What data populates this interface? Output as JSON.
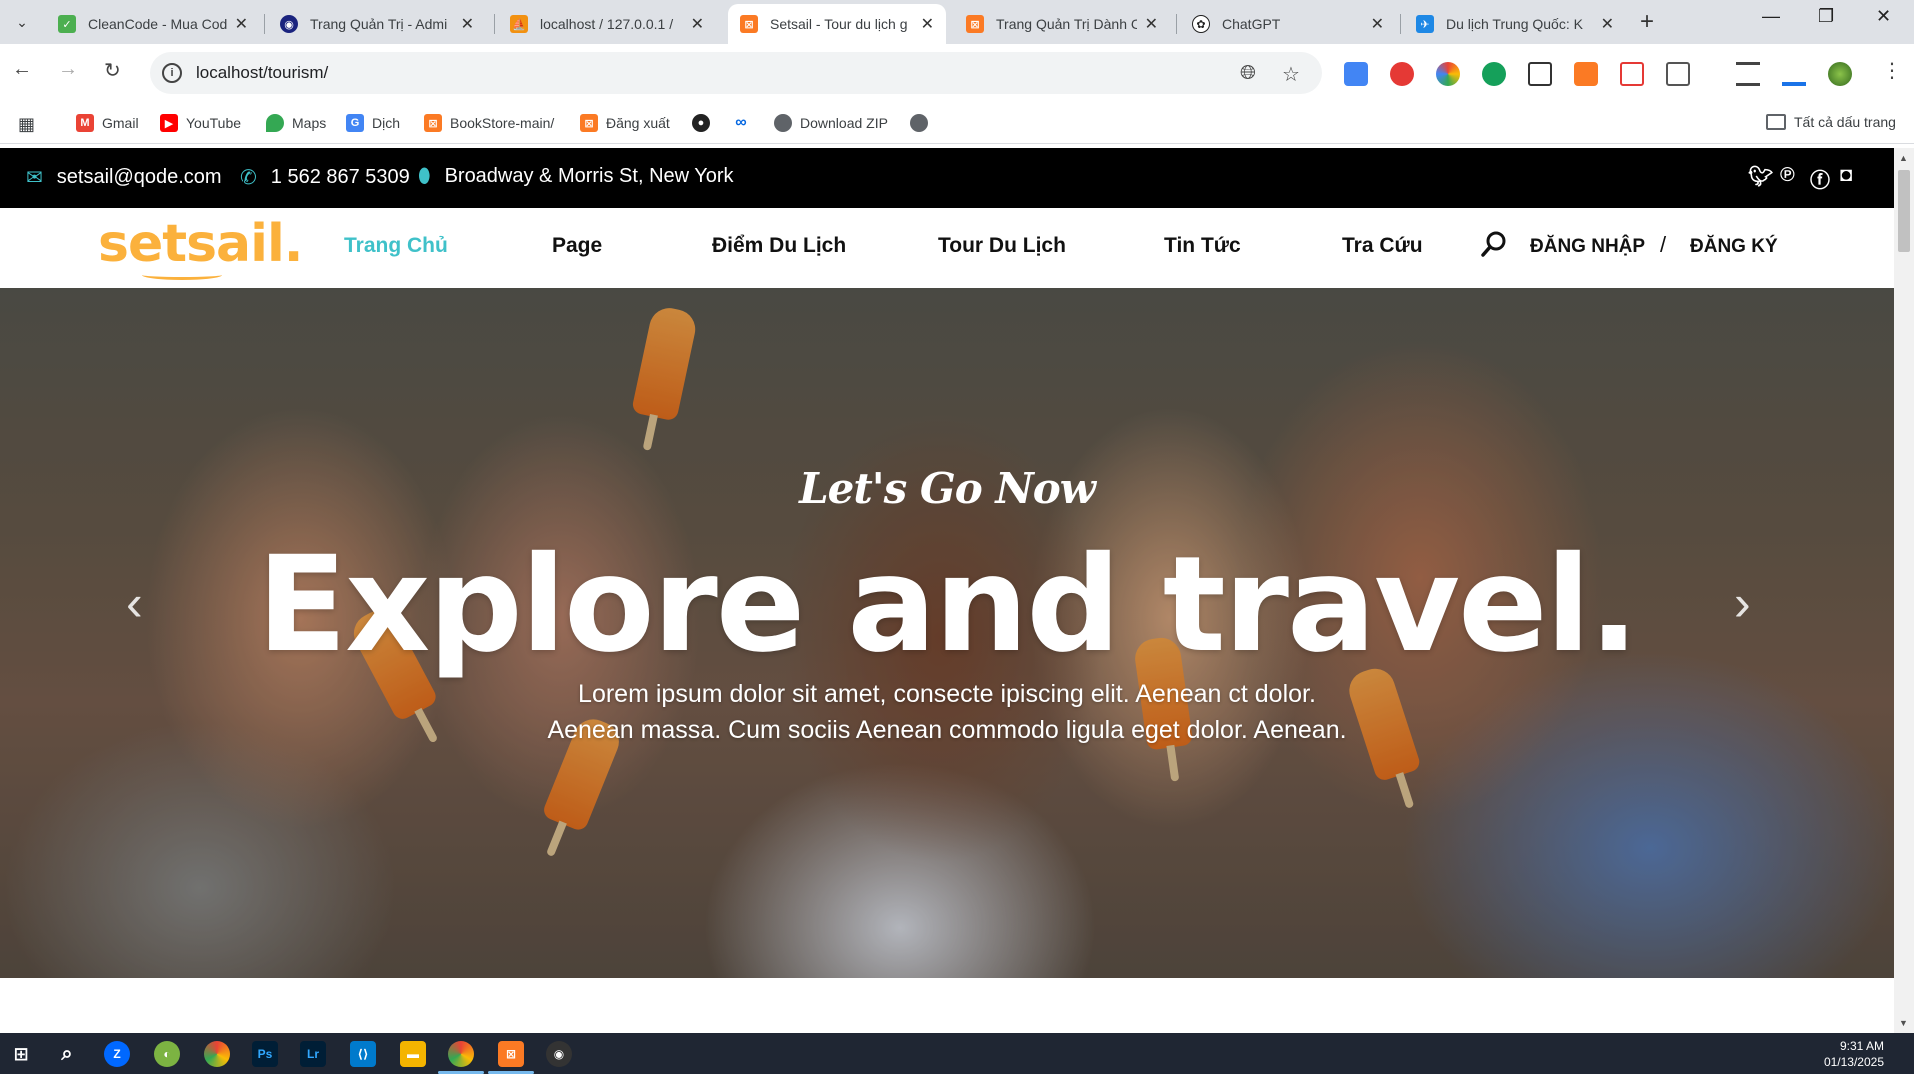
{
  "browser": {
    "tabs": [
      {
        "title": "CleanCode - Mua Cod",
        "icon": "cleancode-favicon",
        "color": "#4caf50"
      },
      {
        "title": "Trang Quản Trị - Admi",
        "icon": "admin-favicon",
        "color": "#1a237e"
      },
      {
        "title": "localhost / 127.0.0.1 /",
        "icon": "phpmyadmin-favicon",
        "color": "#f29111"
      },
      {
        "title": "Setsail - Tour du lịch g",
        "icon": "xampp-favicon",
        "color": "#fb7a24",
        "active": true
      },
      {
        "title": "Trang Quản Trị Dành C",
        "icon": "xampp-favicon",
        "color": "#fb7a24"
      },
      {
        "title": "ChatGPT",
        "icon": "chatgpt-favicon",
        "color": "#202123"
      },
      {
        "title": "Du lịch Trung Quốc: K",
        "icon": "travel-favicon",
        "color": "#1e88e5"
      }
    ],
    "url": "localhost/tourism/",
    "bookmarks": [
      {
        "label": "",
        "icon": "apps-grid-icon"
      },
      {
        "label": "Gmail",
        "icon": "gmail-icon",
        "color": "#ea4335"
      },
      {
        "label": "YouTube",
        "icon": "youtube-icon",
        "color": "#ff0000"
      },
      {
        "label": "Maps",
        "icon": "maps-icon",
        "color": "#34a853"
      },
      {
        "label": "Dịch",
        "icon": "translate-icon",
        "color": "#4285f4"
      },
      {
        "label": "BookStore-main/",
        "icon": "xampp-icon",
        "color": "#fb7a24"
      },
      {
        "label": "Đăng xuất",
        "icon": "xampp-icon",
        "color": "#fb7a24"
      },
      {
        "label": "",
        "icon": "github-icon",
        "color": "#222"
      },
      {
        "label": "",
        "icon": "meta-icon",
        "color": "#0668e1"
      },
      {
        "label": "Download ZIP",
        "icon": "globe-icon",
        "color": "#5f6368"
      },
      {
        "label": "",
        "icon": "globe-icon",
        "color": "#5f6368"
      }
    ],
    "all_bookmarks": "Tất cả dấu trang"
  },
  "site": {
    "top_bar": {
      "email": "setsail@qode.com",
      "phone": "1 562 867 5309",
      "address": "Broadway & Morris St, New York",
      "social": [
        "twitter-icon",
        "pinterest-icon",
        "facebook-icon",
        "instagram-icon"
      ]
    },
    "logo": "setsail.",
    "menu": [
      "Trang Chủ",
      "Page",
      "Điểm Du Lịch",
      "Tour Du Lịch",
      "Tin Tức",
      "Tra Cứu"
    ],
    "login": "ĐĂNG NHẬP",
    "auth_separator": "/",
    "register": "ĐĂNG KÝ",
    "hero": {
      "tagline": "Let's Go Now",
      "headline": "Explore and travel.",
      "line1": "Lorem ipsum dolor sit amet, consecte ipiscing elit. Aenean ct dolor.",
      "line2": "Aenean massa. Cum sociis Aenean commodo ligula eget dolor. Aenean."
    },
    "accent_color": "#3fc1c9",
    "logo_color": "#fbb13c"
  },
  "taskbar": {
    "time": "9:31 AM",
    "date": "01/13/2025"
  }
}
